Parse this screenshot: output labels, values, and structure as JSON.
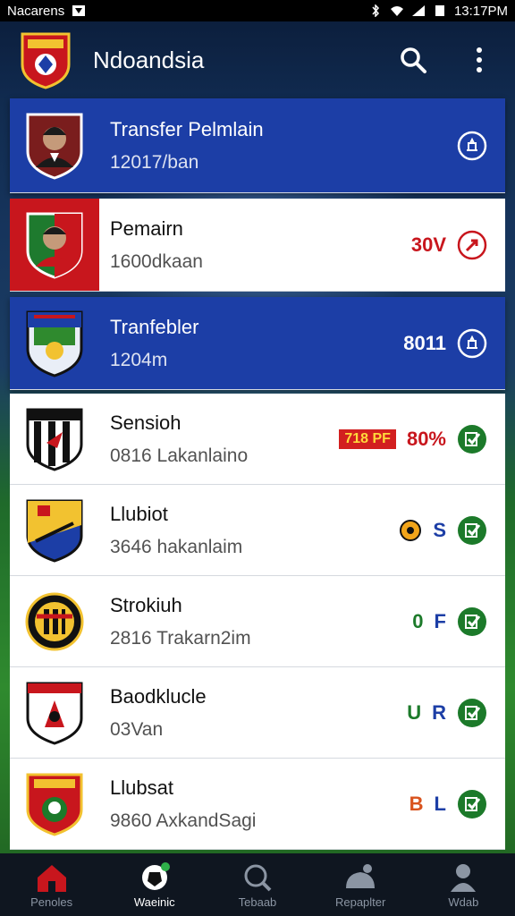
{
  "status_bar": {
    "carrier": "Nacarens",
    "time": "13:17PM"
  },
  "app_bar": {
    "title": "Ndoandsia",
    "logo_icon": "club-crest-icon",
    "search_icon": "search-icon",
    "menu_icon": "more-vert-icon"
  },
  "rows": [
    {
      "name": "Transfer Pelmlain",
      "sub": "12017/ban",
      "badge": "",
      "value": "",
      "style": "blue",
      "crest": "player-photo"
    },
    {
      "name": "Pemairn",
      "sub": "1600dkaan",
      "badge": "",
      "value": "30V",
      "style": "white",
      "crest": "player-photo-red"
    },
    {
      "name": "Tranfebler",
      "sub": "1204m",
      "badge": "",
      "value": "8011",
      "style": "blue",
      "crest": "shield-blue"
    },
    {
      "name": "Sensioh",
      "sub": "0816 Lakanlaino",
      "badge": "718 PF",
      "value": "80%",
      "style": "white",
      "crest": "shield-black-white"
    },
    {
      "name": "Llubiot",
      "sub": "3646 hakanlaim",
      "badge": "",
      "value": "S",
      "style": "white",
      "crest": "shield-yellow-blue"
    },
    {
      "name": "Strokiuh",
      "sub": "2816 Trakarn2im",
      "badge": "",
      "value": "F",
      "style": "white",
      "crest": "round-black"
    },
    {
      "name": "Baodklucle",
      "sub": "03Van",
      "badge": "",
      "value": "R",
      "style": "white",
      "crest": "shield-white-red"
    },
    {
      "name": "Llubsat",
      "sub": "9860 AxkandSagi",
      "badge": "",
      "value": "L",
      "style": "white",
      "crest": "shield-red-green"
    }
  ],
  "row_markers": [
    "",
    "",
    "",
    "",
    "",
    "0",
    "U",
    "B"
  ],
  "bottom_nav": [
    {
      "label": "Penoles",
      "icon": "home-icon",
      "active": false
    },
    {
      "label": "Waeinic",
      "icon": "soccer-ball-icon",
      "active": true
    },
    {
      "label": "Tebaab",
      "icon": "search-icon",
      "active": false
    },
    {
      "label": "Repaplter",
      "icon": "stadium-icon",
      "active": false
    },
    {
      "label": "Wdab",
      "icon": "profile-icon",
      "active": false
    }
  ],
  "colors": {
    "blue_row": "#1c3ea6",
    "red_accent": "#c8161d",
    "green_accent": "#1c7a2a"
  }
}
